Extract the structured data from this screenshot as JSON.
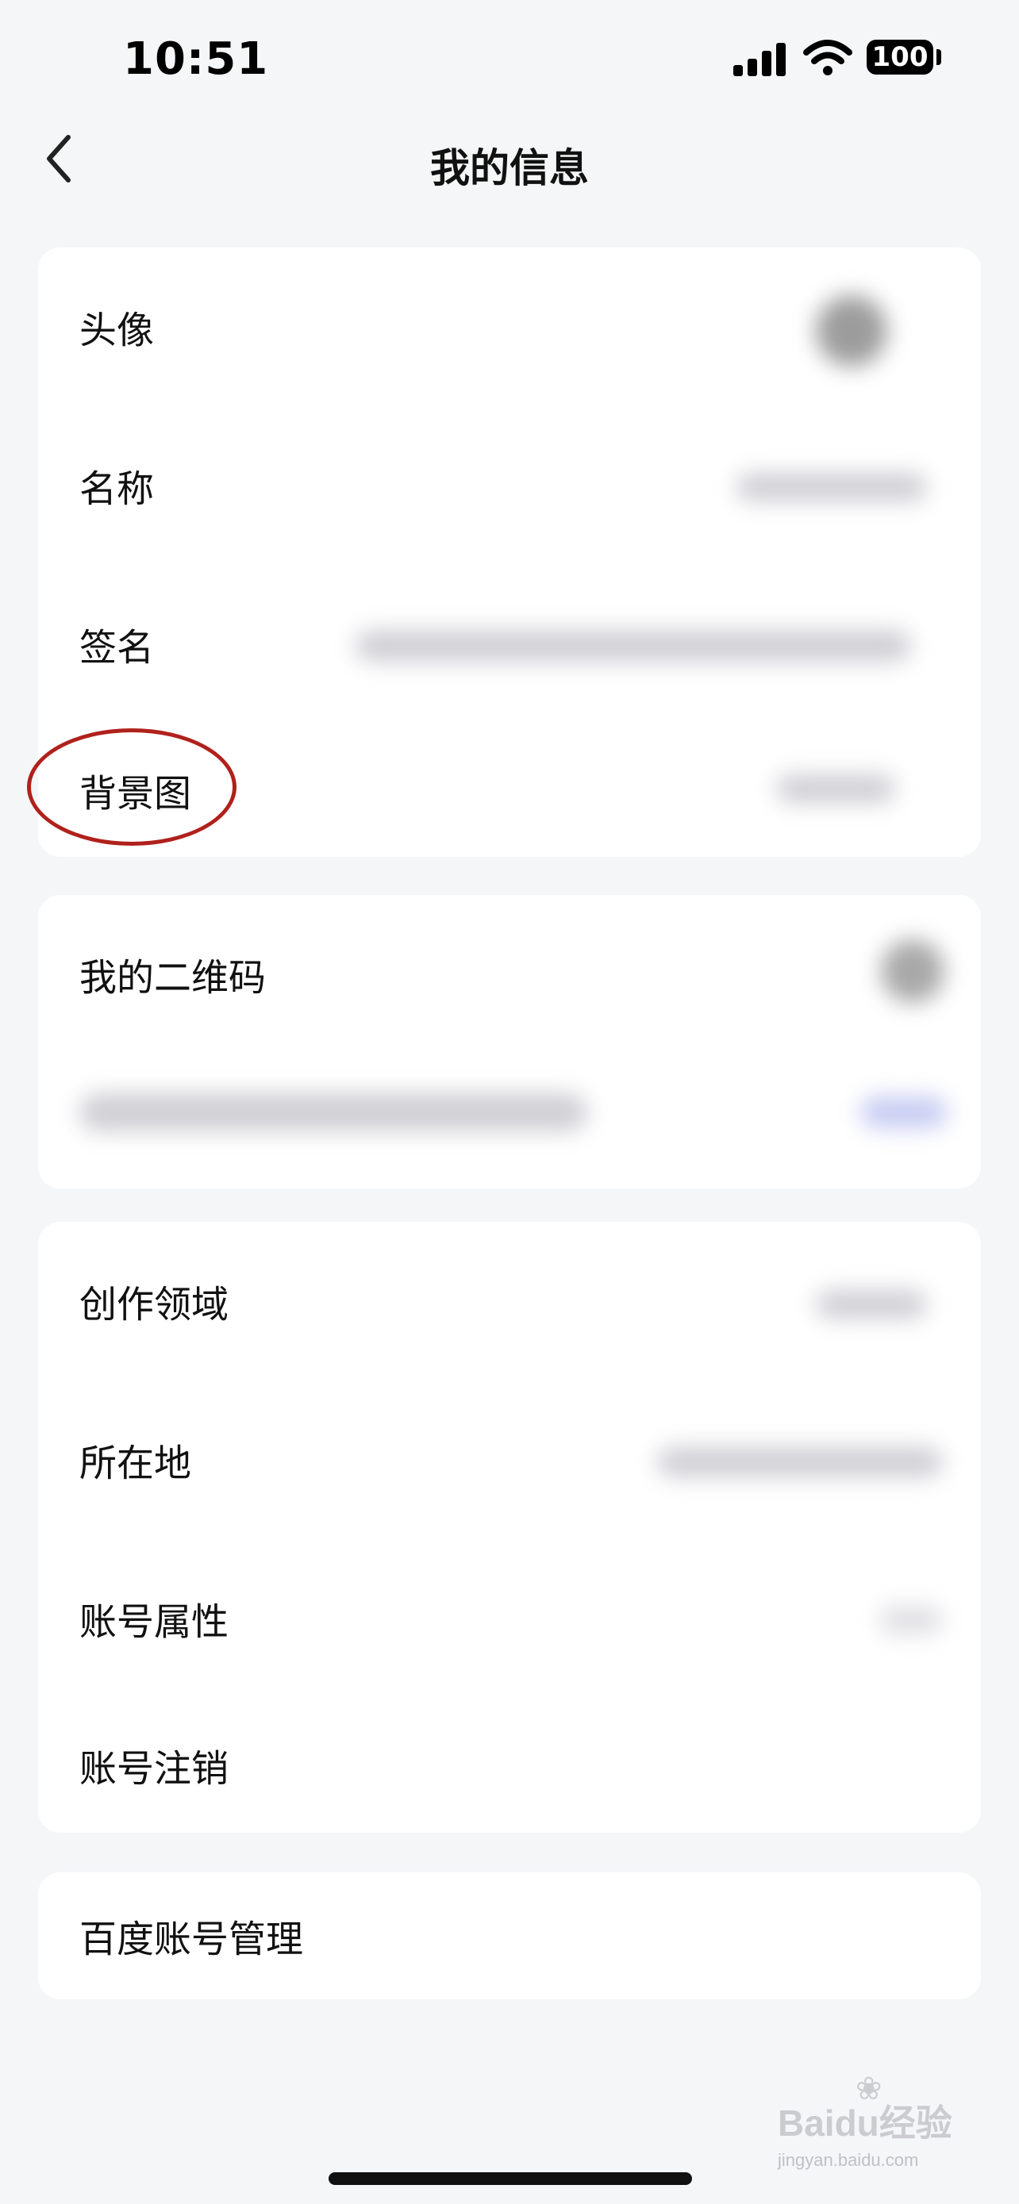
{
  "status_bar": {
    "time": "10:51",
    "battery": "100",
    "signal_icon": "cellular-signal-icon",
    "wifi_icon": "wifi-icon"
  },
  "header": {
    "title": "我的信息",
    "back_icon": "chevron-left-icon"
  },
  "profile_section": {
    "items": [
      {
        "label": "头像"
      },
      {
        "label": "名称"
      },
      {
        "label": "签名"
      },
      {
        "label": "背景图"
      }
    ]
  },
  "qr_section": {
    "items": [
      {
        "label": "我的二维码"
      }
    ]
  },
  "info_section": {
    "items": [
      {
        "label": "创作领域"
      },
      {
        "label": "所在地"
      },
      {
        "label": "账号属性"
      },
      {
        "label": "账号注销"
      }
    ]
  },
  "account_section": {
    "items": [
      {
        "label": "百度账号管理"
      }
    ]
  },
  "watermark": {
    "brand": "Baidu",
    "suffix": "经验",
    "url": "jingyan.baidu.com"
  },
  "colors": {
    "highlight": "#b0211c",
    "background": "#f5f6f8"
  }
}
